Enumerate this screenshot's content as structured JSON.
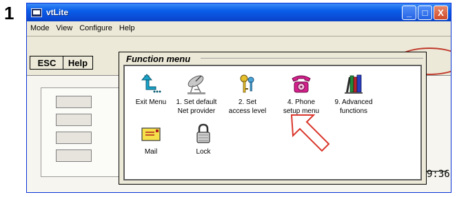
{
  "step_number": "1",
  "window": {
    "title": "vtLite",
    "controls": {
      "minimize": "_",
      "maximize": "□",
      "close": "X"
    }
  },
  "menubar": {
    "items": [
      "Mode",
      "View",
      "Configure",
      "Help"
    ]
  },
  "toolbar": {
    "esc_label": "ESC",
    "help_label": "Help"
  },
  "clock": {
    "time": "9:36"
  },
  "function_menu": {
    "title": "Function menu",
    "items": [
      {
        "label": "Exit Menu",
        "icon": "exit-arrow-icon"
      },
      {
        "label": "1. Set default\nNet provider",
        "icon": "satellite-dish-icon"
      },
      {
        "label": "2. Set\naccess level",
        "icon": "keys-icon"
      },
      {
        "label": "4. Phone\nsetup menu",
        "icon": "phone-icon"
      },
      {
        "label": "9. Advanced\nfunctions",
        "icon": "books-icon"
      },
      {
        "label": "Mail",
        "icon": "mail-icon"
      },
      {
        "label": "Lock",
        "icon": "lock-icon"
      }
    ]
  },
  "colors": {
    "titlebar": "#0a5ee8",
    "dialog_bg": "#ece9d8",
    "pointer_arrow": "#d9362b",
    "phone": "#d4208c"
  }
}
